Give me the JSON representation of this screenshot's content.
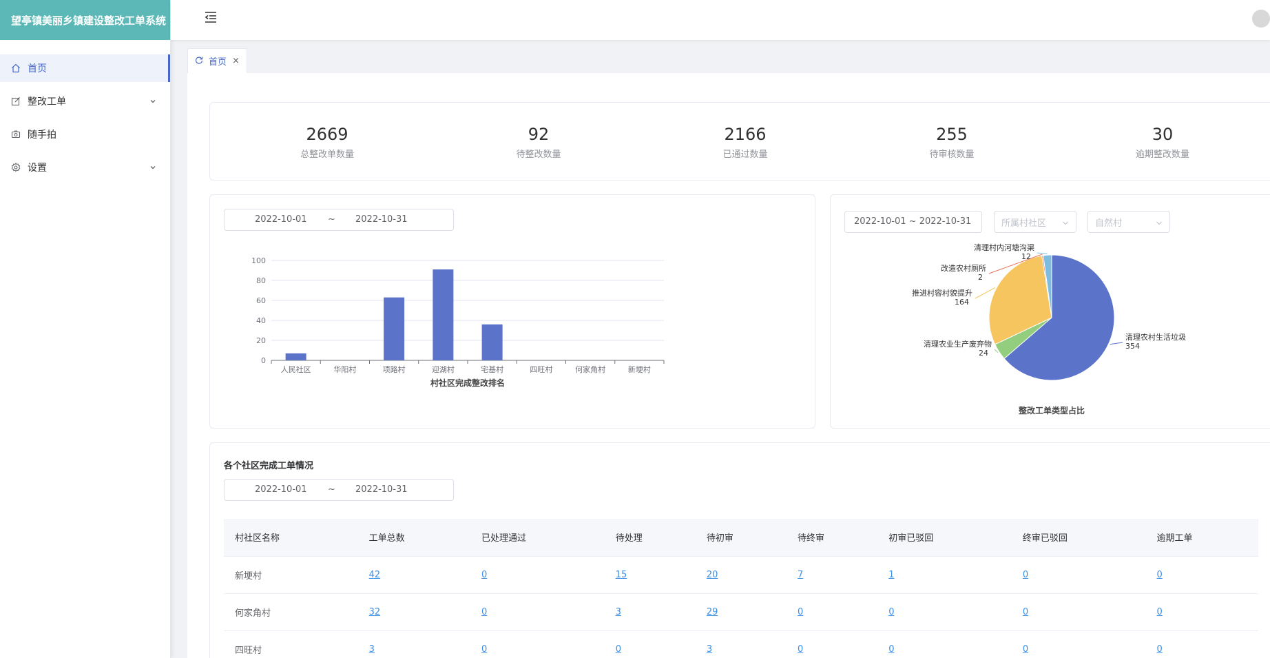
{
  "app": {
    "title": "望亭镇美丽乡镇建设整改工单系统"
  },
  "sidebar": {
    "items": [
      {
        "label": "首页",
        "icon": "home-icon",
        "active": true
      },
      {
        "label": "整改工单",
        "icon": "edit-icon",
        "expandable": true
      },
      {
        "label": "随手拍",
        "icon": "camera-icon"
      },
      {
        "label": "设置",
        "icon": "gear-icon",
        "expandable": true
      }
    ]
  },
  "tabs": [
    {
      "label": "首页",
      "icon": "refresh-icon",
      "close": "×"
    }
  ],
  "stats": [
    {
      "value": "2669",
      "label": "总整改单数量"
    },
    {
      "value": "92",
      "label": "待整改数量"
    },
    {
      "value": "2166",
      "label": "已通过数量"
    },
    {
      "value": "255",
      "label": "待审核数量"
    },
    {
      "value": "30",
      "label": "逾期整改数量"
    }
  ],
  "bar_filter": {
    "start": "2022-10-01",
    "sep": "~",
    "end": "2022-10-31"
  },
  "pie_filter": {
    "range": "2022-10-01 ~ 2022-10-31",
    "community_placeholder": "所属村社区",
    "village_placeholder": "自然村"
  },
  "colors": {
    "accent": "#4868c8",
    "logo_bg": "#5bb8b6",
    "bar": "#5b73c8",
    "pie": [
      "#5b73c8",
      "#93cd7e",
      "#f6c55f",
      "#e8735c",
      "#7dbee0"
    ]
  },
  "chart_data": [
    {
      "type": "bar",
      "title": "村社区完成整改排名",
      "categories": [
        "人民社区",
        "华阳村",
        "项路村",
        "迎湖村",
        "宅基村",
        "四旺村",
        "何家角村",
        "新埂村"
      ],
      "values": [
        7,
        0,
        63,
        91,
        36,
        0,
        0,
        0
      ],
      "ylim": [
        0,
        100
      ],
      "yticks": [
        "0",
        "20",
        "40",
        "60",
        "80",
        "100"
      ],
      "grid": true
    },
    {
      "type": "pie",
      "title": "整改工单类型占比",
      "slices": [
        {
          "label": "清理农村生活垃圾",
          "value": 354
        },
        {
          "label": "清理农业生产废弃物",
          "value": 24
        },
        {
          "label": "推进村容村貌提升",
          "value": 164
        },
        {
          "label": "改造农村厕所",
          "value": 2
        },
        {
          "label": "清理村内河塘沟渠",
          "value": 12
        }
      ]
    }
  ],
  "table_section": {
    "title": "各个社区完成工单情况",
    "filter": {
      "start": "2022-10-01",
      "sep": "~",
      "end": "2022-10-31"
    },
    "columns": [
      "村社区名称",
      "工单总数",
      "已处理通过",
      "待处理",
      "待初审",
      "待终审",
      "初审已驳回",
      "终审已驳回",
      "逾期工单"
    ],
    "rows": [
      [
        "新埂村",
        "42",
        "0",
        "15",
        "20",
        "7",
        "1",
        "0",
        "0"
      ],
      [
        "何家角村",
        "32",
        "0",
        "3",
        "29",
        "0",
        "0",
        "0",
        "0"
      ],
      [
        "四旺村",
        "3",
        "0",
        "0",
        "3",
        "0",
        "0",
        "0",
        "0"
      ]
    ]
  }
}
